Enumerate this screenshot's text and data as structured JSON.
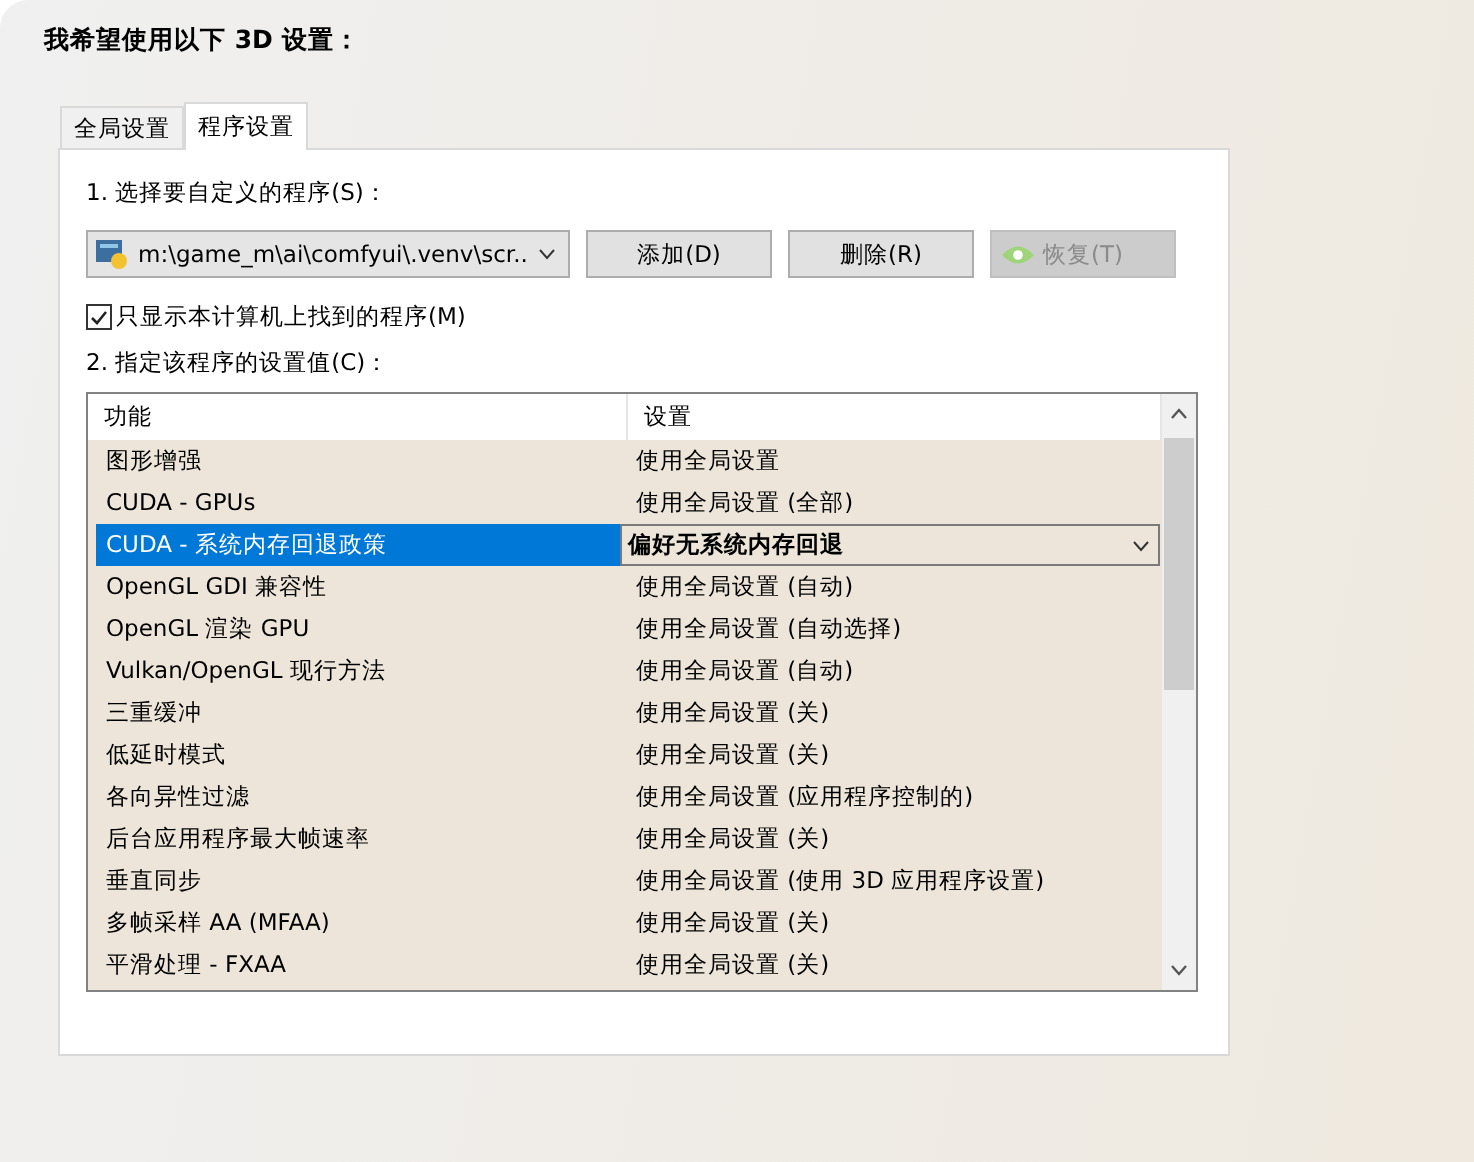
{
  "heading": "我希望使用以下 3D 设置：",
  "tabs": [
    {
      "label": "全局设置",
      "selected": false
    },
    {
      "label": "程序设置",
      "selected": true
    }
  ],
  "program_label": "1. 选择要自定义的程序(S)：",
  "program_select": {
    "value": "m:\\game_m\\ai\\comfyui\\.venv\\scr..."
  },
  "buttons": [
    {
      "label": "添加(D)",
      "disabled": false,
      "kind": "text"
    },
    {
      "label": "删除(R)",
      "disabled": false,
      "kind": "text"
    },
    {
      "label": "恢复(T)",
      "disabled": true,
      "kind": "logo"
    }
  ],
  "filter_checkbox": {
    "label": "只显示本计算机上找到的程序(M)",
    "checked": true
  },
  "settings_label": "2. 指定该程序的设置值(C)：",
  "table": {
    "columns": [
      "功能",
      "设置"
    ],
    "rows": [
      {
        "feature": "图形增强",
        "setting": "使用全局设置",
        "selected": false
      },
      {
        "feature": "CUDA - GPUs",
        "setting": "使用全局设置 (全部)",
        "selected": false
      },
      {
        "feature": "CUDA - 系统内存回退政策",
        "setting": "偏好无系统内存回退",
        "selected": true
      },
      {
        "feature": "OpenGL GDI 兼容性",
        "setting": "使用全局设置 (自动)",
        "selected": false
      },
      {
        "feature": "OpenGL 渲染 GPU",
        "setting": "使用全局设置 (自动选择)",
        "selected": false
      },
      {
        "feature": "Vulkan/OpenGL 现行方法",
        "setting": "使用全局设置 (自动)",
        "selected": false
      },
      {
        "feature": "三重缓冲",
        "setting": "使用全局设置 (关)",
        "selected": false
      },
      {
        "feature": "低延时模式",
        "setting": "使用全局设置 (关)",
        "selected": false
      },
      {
        "feature": "各向异性过滤",
        "setting": "使用全局设置 (应用程序控制的)",
        "selected": false
      },
      {
        "feature": "后台应用程序最大帧速率",
        "setting": "使用全局设置 (关)",
        "selected": false
      },
      {
        "feature": "垂直同步",
        "setting": "使用全局设置 (使用 3D 应用程序设置)",
        "selected": false
      },
      {
        "feature": "多帧采样 AA (MFAA)",
        "setting": "使用全局设置 (关)",
        "selected": false
      },
      {
        "feature": "平滑处理 - FXAA",
        "setting": "使用全局设置 (关)",
        "selected": false
      }
    ]
  }
}
